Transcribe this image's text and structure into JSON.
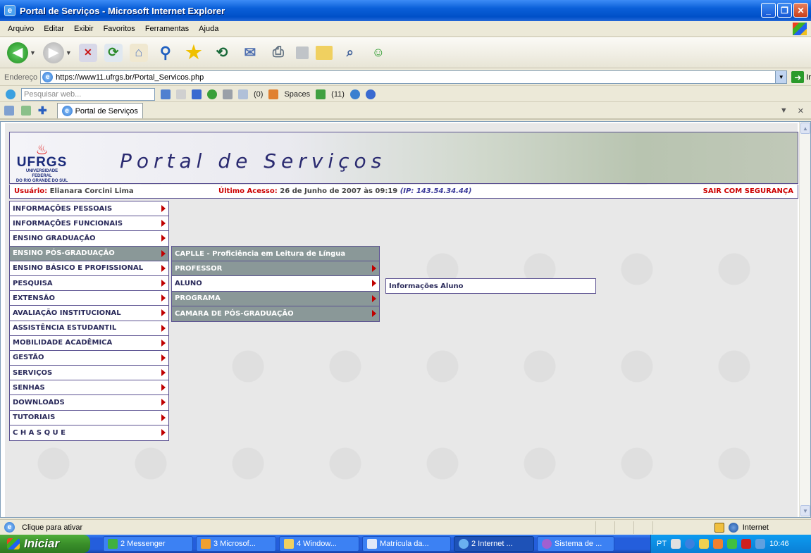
{
  "window": {
    "title": "Portal de Serviços - Microsoft Internet Explorer"
  },
  "menubar": [
    "Arquivo",
    "Editar",
    "Exibir",
    "Favoritos",
    "Ferramentas",
    "Ajuda"
  ],
  "address": {
    "label": "Endereço",
    "url": "https://www11.ufrgs.br/Portal_Servicos.php",
    "go": "Ir"
  },
  "searchbar": {
    "placeholder": "Pesquisar web...",
    "counter1": "(0)",
    "spaces": "Spaces",
    "counter2": "(11)"
  },
  "tab": {
    "label": "Portal de Serviços"
  },
  "banner": {
    "logo_name": "UFRGS",
    "logo_sub1": "UNIVERSIDADE FEDERAL",
    "logo_sub2": "DO RIO GRANDE DO SUL",
    "title": "Portal de Serviços"
  },
  "info": {
    "user_label": "Usuário:",
    "user_name": "Elianara Corcini Lima",
    "access_label": "Último Acesso:",
    "access_value": "26 de Junho de 2007 às 09:19",
    "ip": "(IP: 143.54.34.44)",
    "logout": "SAIR COM SEGURANÇA"
  },
  "menu": [
    "INFORMAÇÕES PESSOAIS",
    "INFORMAÇÕES FUNCIONAIS",
    "ENSINO GRADUAÇÃO",
    "ENSINO PÓS-GRADUAÇÃO",
    "ENSINO BÁSICO E PROFISSIONAL",
    "PESQUISA",
    "EXTENSÃO",
    "AVALIAÇÃO INSTITUCIONAL",
    "ASSISTÊNCIA ESTUDANTIL",
    "MOBILIDADE ACADÊMICA",
    "GESTÃO",
    "SERVIÇOS",
    "SENHAS",
    "DOWNLOADS",
    "TUTORIAIS",
    "C H A S Q U E"
  ],
  "submenu": [
    "CAPLLE - Proficiência em Leitura de Língua",
    "PROFESSOR",
    "ALUNO",
    "PROGRAMA",
    "CAMARA DE PÓS-GRADUAÇÃO"
  ],
  "submenu2": [
    "Informações Aluno"
  ],
  "status": {
    "text": "Clique para ativar",
    "zone": "Internet"
  },
  "taskbar": {
    "start": "Iniciar",
    "tasks": [
      "2 Messenger",
      "3 Microsof...",
      "4 Window...",
      "Matrícula da...",
      "2 Internet ...",
      "Sistema de ..."
    ],
    "lang": "PT",
    "clock": "10:46"
  }
}
